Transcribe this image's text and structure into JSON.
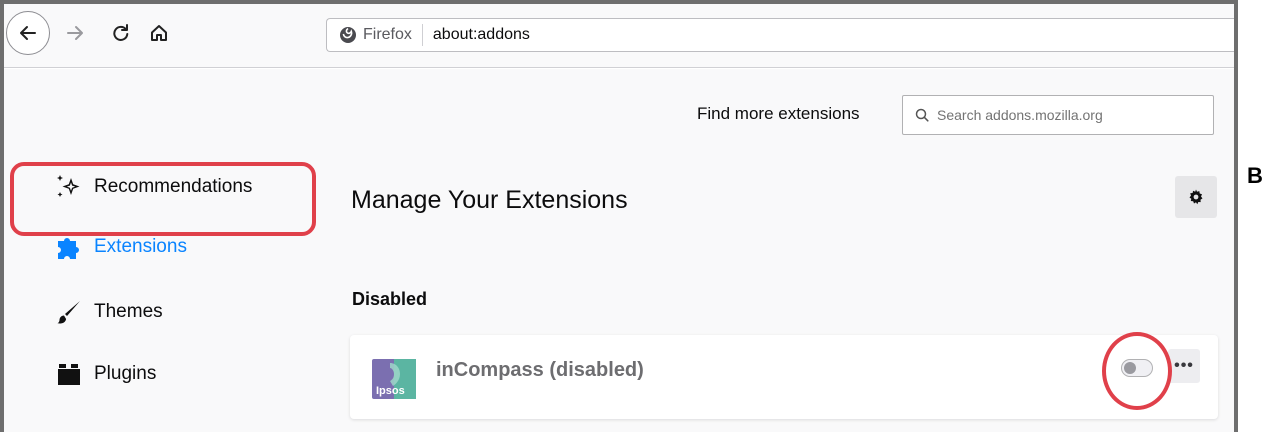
{
  "browser": {
    "identity_label": "Firefox",
    "url": "about:addons"
  },
  "header": {
    "find_more_label": "Find more extensions",
    "search_placeholder": "Search addons.mozilla.org"
  },
  "sidebar": {
    "items": [
      {
        "label": "Recommendations",
        "icon": "sparkles-icon",
        "selected": false
      },
      {
        "label": "Extensions",
        "icon": "puzzle-piece-icon",
        "selected": true
      },
      {
        "label": "Themes",
        "icon": "paintbrush-icon",
        "selected": false
      },
      {
        "label": "Plugins",
        "icon": "plugin-block-icon",
        "selected": false
      }
    ]
  },
  "main": {
    "title": "Manage Your Extensions",
    "section_heading": "Disabled",
    "extension": {
      "name": "inCompass (disabled)",
      "icon_text": "Ipsos",
      "enabled": false
    },
    "more_label": "•••"
  },
  "annotation": {
    "corner_label": "B"
  },
  "colors": {
    "accent": "#0a84ff",
    "annotation_red": "#e0404a",
    "ipsos_green": "#5bb5a2",
    "ipsos_purple": "#7b6fb0"
  }
}
